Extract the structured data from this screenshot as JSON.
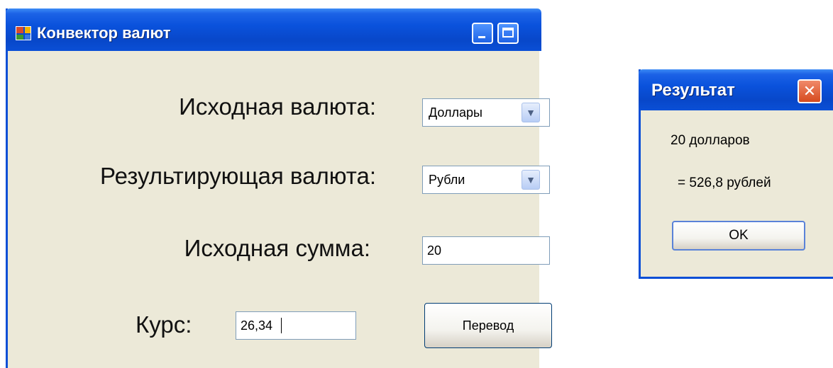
{
  "main_window": {
    "title": "Конвектор валют",
    "labels": {
      "source_currency": "Исходная валюта:",
      "target_currency": "Результирующая валюта:",
      "amount": "Исходная сумма:",
      "rate": "Курс:"
    },
    "source_currency_value": "Доллары",
    "target_currency_value": "Рубли",
    "amount_value": "20",
    "rate_value": "26,34",
    "convert_button": "Перевод"
  },
  "result_dialog": {
    "title": "Результат",
    "line1": "20 долларов",
    "line2": "= 526,8 рублей",
    "ok_button": "OK"
  },
  "icons": {
    "titlebar_app": "app-icon",
    "minimize": "minimize-icon",
    "maximize": "maximize-icon",
    "dropdown": "chevron-down-icon",
    "close": "close-icon"
  },
  "colors": {
    "titlebar_blue": "#0a52dc",
    "window_face": "#ece9d8",
    "close_red": "#d64a1e"
  }
}
